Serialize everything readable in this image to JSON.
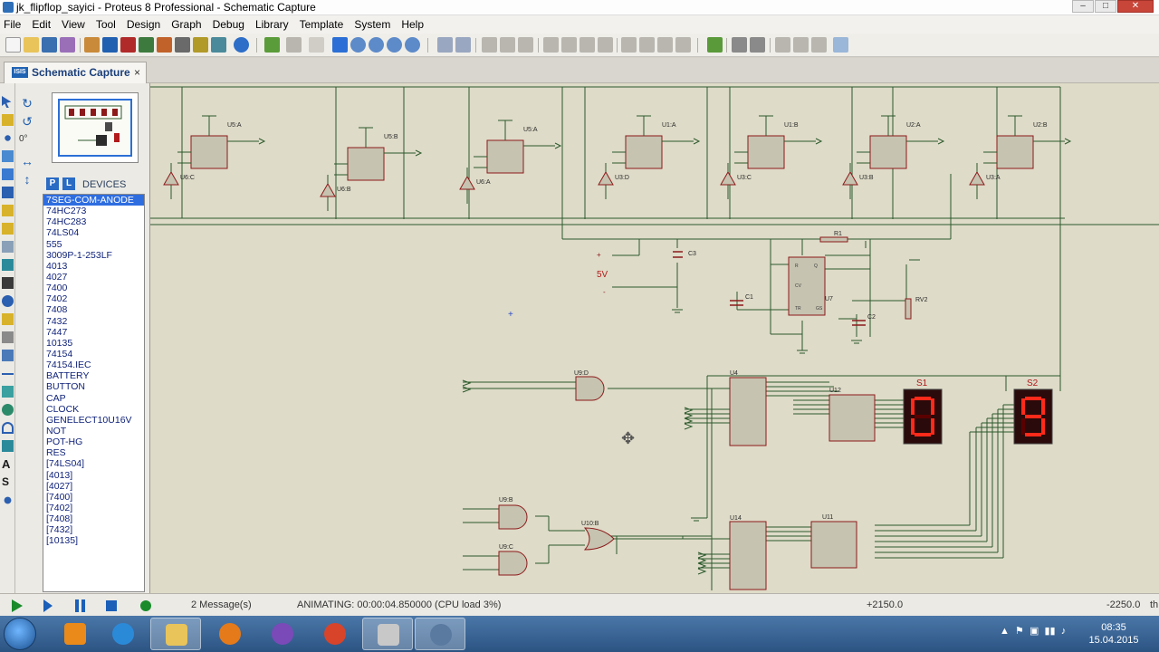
{
  "window": {
    "title": "jk_flipflop_sayici - Proteus 8 Professional - Schematic Capture"
  },
  "menu": [
    "File",
    "Edit",
    "View",
    "Tool",
    "Design",
    "Graph",
    "Debug",
    "Library",
    "Template",
    "System",
    "Help"
  ],
  "tab": {
    "icon_text": "ISIS",
    "label": "Schematic Capture",
    "close": "×"
  },
  "side": {
    "rotation_angle": "0°",
    "picker_p": "P",
    "picker_l": "L",
    "devices_label": "DEVICES",
    "devices": [
      "7SEG-COM-ANODE",
      "74HC273",
      "74HC283",
      "74LS04",
      "555",
      "3009P-1-253LF",
      "4013",
      "4027",
      "7400",
      "7402",
      "7408",
      "7432",
      "7447",
      "10135",
      "74154",
      "74154.IEC",
      "BATTERY",
      "BUTTON",
      "CAP",
      "CLOCK",
      "GENELECT10U16V",
      "NOT",
      "POT-HG",
      "RES",
      "[74LS04]",
      "[4013]",
      "[4027]",
      "[7400]",
      "[7402]",
      "[7408]",
      "[7432]",
      "[10135]"
    ],
    "selected_index": 0
  },
  "schematic": {
    "flipflops": [
      {
        "ref": "U5:A",
        "inv": "U6:C"
      },
      {
        "ref": "U5:B",
        "inv": "U6:B"
      },
      {
        "ref": "U5:A",
        "inv": "U6:A"
      },
      {
        "ref": "U1:A",
        "inv": "U3:D"
      },
      {
        "ref": "U1:B",
        "inv": "U3:C"
      },
      {
        "ref": "U2:A",
        "inv": "U3:B"
      },
      {
        "ref": "U2:B",
        "inv": "U3:A"
      }
    ],
    "timer": {
      "ref": "U7",
      "r1": "R1",
      "c1": "C1",
      "c2": "C2",
      "c3": "C3",
      "pot": "RV2",
      "supply": "5V"
    },
    "gates": {
      "and1": "U9:D",
      "and2": "U9:B",
      "and3": "U9:C",
      "or1": "U10:B"
    },
    "chips": {
      "u4": "U4",
      "u14": "U14",
      "u12": "U12",
      "u11": "U11"
    },
    "displays": [
      {
        "ref": "S1",
        "digit": "0"
      },
      {
        "ref": "S2",
        "digit": "9"
      }
    ]
  },
  "status": {
    "messages": "2 Message(s)",
    "animating": "ANIMATING: 00:00:04.850000 (CPU load 3%)",
    "coord_x": "+2150.0",
    "coord_y": "-2250.0",
    "unit": "th"
  },
  "taskbar": {
    "time": "08:35",
    "date": "15.04.2015"
  },
  "colors": {
    "canvas": "#dedbc8",
    "wire": "#2c5a2c",
    "component": "#8c1a1a",
    "segment_on": "#ff2a1a",
    "segment_off": "#5a0000",
    "accent": "#2e6de0"
  }
}
